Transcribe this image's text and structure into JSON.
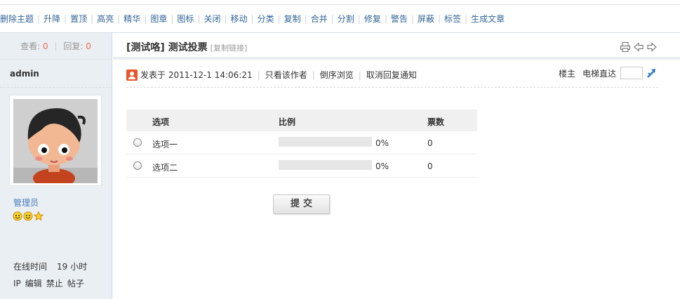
{
  "mod_actions": [
    "删除主题",
    "升降",
    "置顶",
    "高亮",
    "精华",
    "图章",
    "图标",
    "关闭",
    "移动",
    "分类",
    "复制",
    "合并",
    "分割",
    "修复",
    "警告",
    "屏蔽",
    "标签",
    "生成文章"
  ],
  "sidebar": {
    "views_label": "查看:",
    "views": "0",
    "replies_label": "回复:",
    "replies": "0",
    "author": "admin",
    "group": "管理员",
    "online_label": "在线时间",
    "online_value": "19 小时",
    "links": [
      "IP",
      "编辑",
      "禁止",
      "帖子"
    ]
  },
  "thread": {
    "title": "[测试咯] 测试投票",
    "copy_link": "[复制链接]"
  },
  "post": {
    "posted_at": "发表于 2011-12-1 14:06:21",
    "only_author": "只看该作者",
    "reverse": "倒序浏览",
    "cancel_notify": "取消回复通知",
    "floor": "楼主",
    "jump_label": "电梯直达"
  },
  "poll": {
    "headers": [
      "选项",
      "比例",
      "票数"
    ],
    "options": [
      {
        "label": "选项一",
        "percent": "0%",
        "fraction": 0,
        "votes": "0"
      },
      {
        "label": "选项二",
        "percent": "0%",
        "fraction": 0,
        "votes": "0"
      }
    ],
    "submit_label": "提交"
  },
  "colors": {
    "link": "#336699",
    "sidebar_bg": "#eaeff3",
    "count_accent": "#f26c4f",
    "group_link": "#4a7cbf"
  }
}
